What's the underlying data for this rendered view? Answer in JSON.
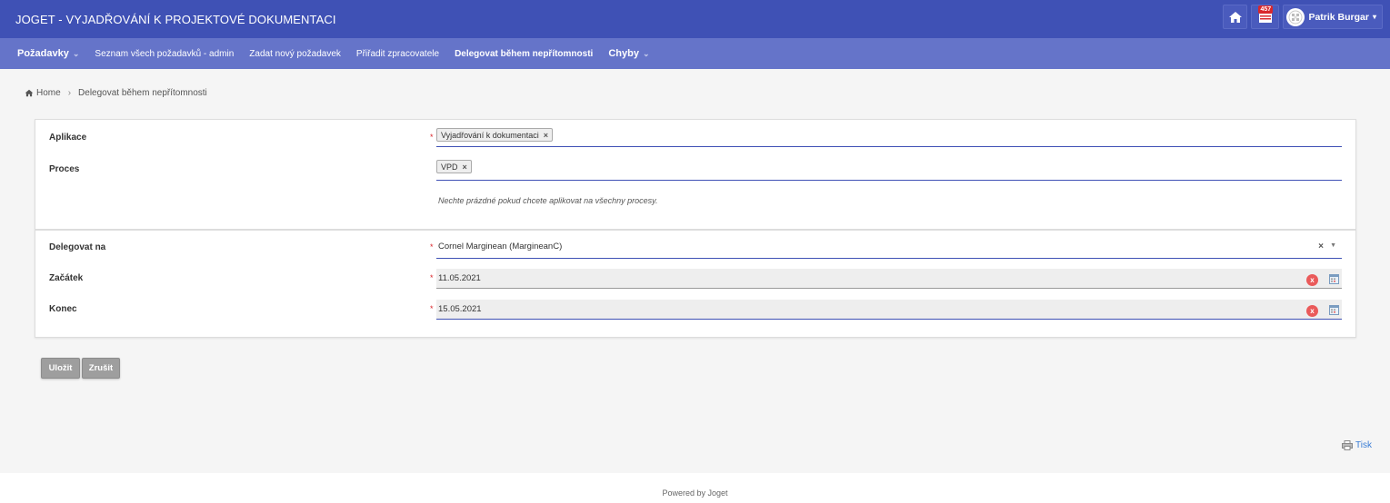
{
  "header": {
    "title": "JOGET - VYJADŘOVÁNÍ K PROJEKTOVÉ DOKUMENTACI",
    "inbox_count": "457",
    "user_name": "Patrik Burgar"
  },
  "nav": {
    "items": [
      {
        "label": "Požadavky",
        "dropdown": true
      },
      {
        "label": "Seznam všech požadavků - admin"
      },
      {
        "label": "Zadat nový požadavek"
      },
      {
        "label": "Přiřadit zpracovatele"
      },
      {
        "label": "Delegovat během nepřítomnosti"
      },
      {
        "label": "Chyby",
        "dropdown": true
      }
    ]
  },
  "breadcrumb": {
    "home": "Home",
    "current": "Delegovat během nepřítomnosti"
  },
  "form": {
    "aplikace_label": "Aplikace",
    "aplikace_value": "Vyjadřování k dokumentaci",
    "proces_label": "Proces",
    "proces_value": "VPD",
    "proces_hint": "Nechte prázdné pokud chcete aplikovat na všechny procesy.",
    "delegovat_label": "Delegovat na",
    "delegovat_value": "Cornel Marginean (MargineanC)",
    "zacatek_label": "Začátek",
    "zacatek_value": "11.05.2021",
    "konec_label": "Konec",
    "konec_value": "15.05.2021",
    "required_mark": "*",
    "chip_remove": "×",
    "clear_symbol": "×",
    "date_clear_symbol": "x"
  },
  "buttons": {
    "save": "Uložit",
    "cancel": "Zrušit"
  },
  "print_label": "Tisk",
  "footer": "Powered by Joget",
  "colors": {
    "header_bg": "#3f51b5",
    "nav_bg": "#6574c9",
    "badge": "#d9262b",
    "required": "#d9262b",
    "button": "#9e9e9e",
    "link": "#3b7ed6"
  }
}
